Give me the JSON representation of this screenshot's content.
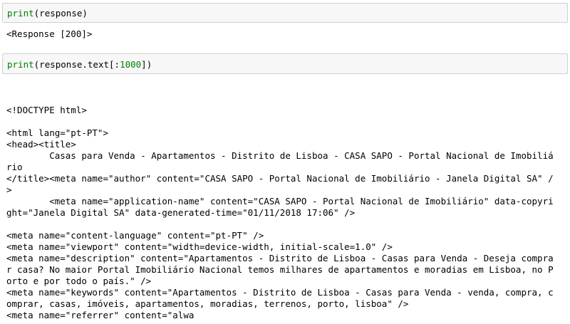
{
  "cells": [
    {
      "input": {
        "func": "print",
        "args": "(response)"
      },
      "output": "<Response [200]>"
    },
    {
      "input": {
        "func": "print",
        "args_pre": "(response.text[:",
        "num": "1000",
        "args_post": "])"
      },
      "output_lines": [
        "<!DOCTYPE html>",
        "",
        "<html lang=\"pt-PT\">",
        "<head><title>",
        "        Casas para Venda - Apartamentos - Distrito de Lisboa - CASA SAPO - Portal Nacional de Imobiliá",
        "rio",
        "</title><meta name=\"author\" content=\"CASA SAPO - Portal Nacional de Imobiliário - Janela Digital SA\" /",
        ">",
        "        <meta name=\"application-name\" content=\"CASA SAPO - Portal Nacional de Imobiliário\" data-copyri",
        "ght=\"Janela Digital SA\" data-generated-time=\"01/11/2018 17:06\" />",
        "",
        "<meta name=\"content-language\" content=\"pt-PT\" />",
        "<meta name=\"viewport\" content=\"width=device-width, initial-scale=1.0\" />",
        "<meta name=\"description\" content=\"Apartamentos - Distrito de Lisboa - Casas para Venda - Deseja compra",
        "r casa? No maior Portal Imobiliário Nacional temos milhares de apartamentos e moradias em Lisboa, no P",
        "orto e por todo o país.\" />",
        "<meta name=\"keywords\" content=\"Apartamentos - Distrito de Lisboa - Casas para Venda - venda, compra, c",
        "omprar, casas, imóveis, apartamentos, moradias, terrenos, porto, lisboa\" />",
        "<meta name=\"referrer\" content=\"alwa"
      ]
    }
  ]
}
